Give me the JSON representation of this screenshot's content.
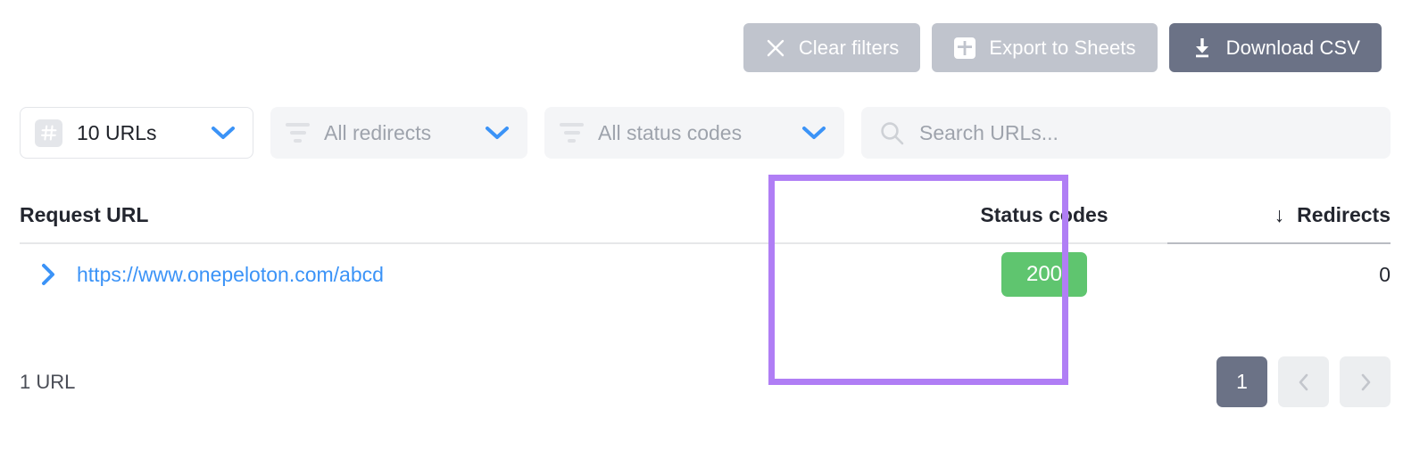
{
  "toolbar": {
    "clear_filters": {
      "label": "Clear filters",
      "icon": "close-icon",
      "style": "muted"
    },
    "export_sheets": {
      "label": "Export to Sheets",
      "icon": "sheets-icon",
      "style": "muted"
    },
    "download_csv": {
      "label": "Download CSV",
      "icon": "download-icon",
      "style": "solid"
    }
  },
  "filters": {
    "url_count": {
      "label": "10 URLs",
      "icon": "hash-icon"
    },
    "redirects": {
      "label": "All redirects",
      "icon": "filter-icon"
    },
    "status_codes": {
      "label": "All status codes",
      "icon": "filter-icon"
    },
    "search": {
      "placeholder": "Search URLs...",
      "value": "",
      "icon": "search-icon"
    }
  },
  "table": {
    "headers": {
      "request_url": "Request URL",
      "status_codes": "Status codes",
      "redirects": "Redirects",
      "redirects_sort": "↓"
    },
    "rows": [
      {
        "expand": "›",
        "url": "https://www.onepeloton.com/abcd",
        "status_code": "200",
        "redirects": "0"
      }
    ]
  },
  "footer": {
    "count": "1 URL",
    "pagination": {
      "current": "1",
      "prev": "‹",
      "next": "›"
    }
  },
  "colors": {
    "accent_blue": "#3b93f7",
    "status_200_green": "#5fc56f",
    "highlight_purple": "#b07ef5",
    "button_solid": "#6b7286",
    "button_muted": "#c0c4cd"
  }
}
